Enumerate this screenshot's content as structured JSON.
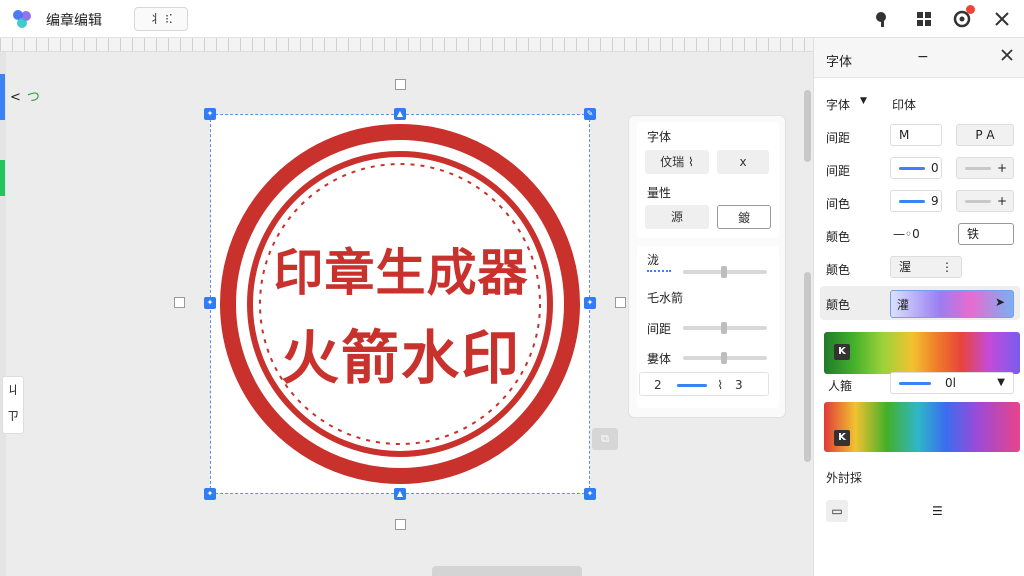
{
  "app": {
    "title": "编章编辑",
    "tool_label": "⺦ ⁝⁚"
  },
  "top_icons": [
    "brush-icon",
    "grid-icon",
    "settings-icon",
    "close-icon"
  ],
  "left": {
    "undo_label": "<",
    "redo_label": "つ",
    "tool1": "ㄐ",
    "tool2": "ㄗ"
  },
  "canvas": {
    "stamp_line1": "印章生成器",
    "stamp_line2": "火箭水印",
    "stamp_color": "#c8312c"
  },
  "float_panel": {
    "font_label": "字体",
    "font_value": "伩瑞 ⌇",
    "font_close": "x",
    "attr_label": "量性",
    "attr_opt1": "源",
    "attr_opt2": "鍍",
    "row1_label": "泷",
    "row2_label": "乇水箭",
    "row3_label": "间距",
    "row4_label": "婁体",
    "range_from": "2",
    "range_to": "3"
  },
  "right_panel": {
    "header_title": "字体",
    "header_min": "−",
    "font_label": "字体",
    "font_value": "印体",
    "spacing1_label": "间距",
    "spacing1_value": "M",
    "spacing1_value2": "P A",
    "spacing2_label": "间距",
    "spacing2_value": "0",
    "spacing2_plus": "+",
    "color1_label": "间色",
    "color1_value": "9",
    "color1_plus": "+",
    "color2_label": "颠色",
    "color2_value": "—◦0",
    "color2_value2": "铁",
    "color3_label": "颠色",
    "color3_value": "渥",
    "color3_suffix": "⋮",
    "color4_label": "颠色",
    "color4_value": "灌",
    "swatch_badge": "K",
    "person_label": "人箍",
    "person_value": "0l",
    "swatch2_badge": "K",
    "outer_label": "外討採",
    "bottom_icon2": "☰"
  }
}
